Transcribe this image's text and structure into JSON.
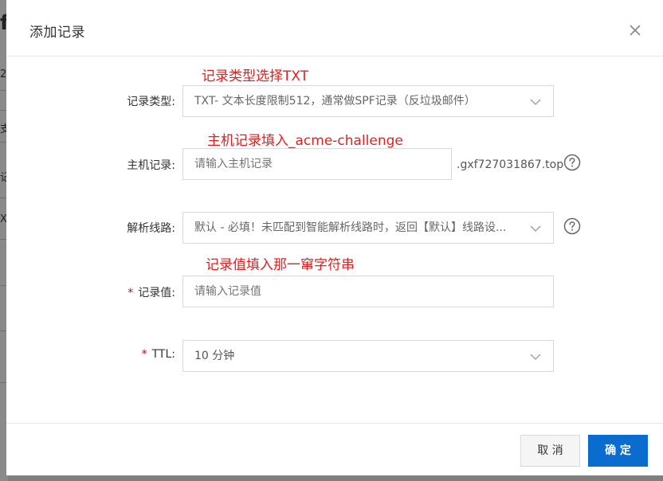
{
  "background": {
    "fragments": [
      "f",
      "2",
      "支",
      "记",
      "X"
    ]
  },
  "dialog": {
    "title": "添加记录",
    "close_icon": "close-icon"
  },
  "annotations": {
    "record_type": "记录类型选择TXT",
    "host": "主机记录填入_acme-challenge",
    "value": "记录值填入那一窜字符串"
  },
  "form": {
    "record_type": {
      "label": "记录类型:",
      "value": "TXT- 文本长度限制512，通常做SPF记录（反垃圾邮件）"
    },
    "host": {
      "label": "主机记录:",
      "placeholder": "请输入主机记录",
      "suffix": ".gxf727031867.top"
    },
    "line": {
      "label": "解析线路:",
      "value": "默认 - 必填！未匹配到智能解析线路时，返回【默认】线路设..."
    },
    "record_value": {
      "required_mark": "*",
      "label": "记录值:",
      "placeholder": "请输入记录值"
    },
    "ttl": {
      "required_mark": "*",
      "label": "TTL:",
      "value": "10 分钟"
    }
  },
  "footer": {
    "cancel_label": "取 消",
    "ok_label": "确 定"
  },
  "colors": {
    "annotation": "#e02020",
    "primary_button": "#0a6ccf",
    "required": "#d9001b"
  }
}
